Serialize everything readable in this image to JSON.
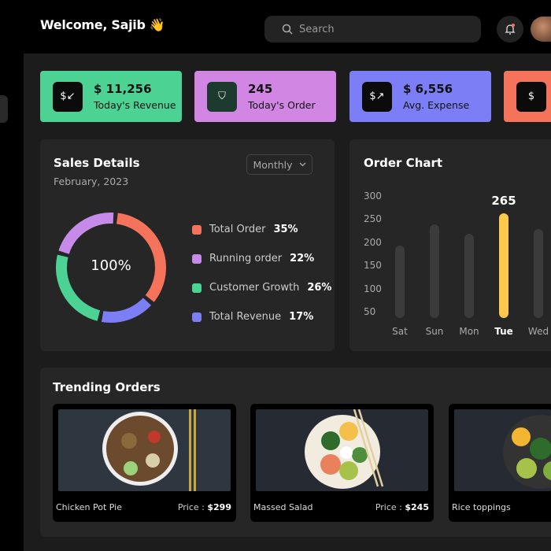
{
  "header": {
    "welcome": "Welcome, Sajib 👋",
    "search_placeholder": "Search"
  },
  "stats": [
    {
      "value": "$ 11,256",
      "label": "Today's Revenue",
      "color": "#4cd394",
      "icon": "dollar-in-icon"
    },
    {
      "value": "245",
      "label": "Today's Order",
      "color": "#d186e3",
      "icon": "user-shield-icon"
    },
    {
      "value": "$ 6,556",
      "label": "Avg. Expense",
      "color": "#7c7ef5",
      "icon": "dollar-out-icon"
    },
    {
      "value": "",
      "label": "",
      "color": "#f5735a",
      "icon": "dollar-icon"
    }
  ],
  "sales": {
    "title": "Sales Details",
    "subtitle": "February, 2023",
    "period": "Monthly",
    "center": "100%",
    "items": [
      {
        "label": "Total Order",
        "pct": "35%",
        "value": 35,
        "color": "#f5735a"
      },
      {
        "label": "Running order",
        "pct": "22%",
        "value": 22,
        "color": "#c68be8"
      },
      {
        "label": "Customer Growth",
        "pct": "26%",
        "value": 26,
        "color": "#4cd394"
      },
      {
        "label": "Total Revenue",
        "pct": "17%",
        "value": 17,
        "color": "#7c7ef5"
      }
    ]
  },
  "chart_data": {
    "type": "bar",
    "title": "Order Chart",
    "categories": [
      "Sat",
      "Sun",
      "Mon",
      "Tue",
      "Wed"
    ],
    "values": [
      195,
      240,
      220,
      265,
      230
    ],
    "yticks": [
      "300",
      "250",
      "200",
      "150",
      "100",
      "50"
    ],
    "ylim": [
      50,
      300
    ],
    "highlight": "Tue",
    "highlight_label": "265",
    "bar_color": "#3b3b3b",
    "highlight_color": "#fcc94a"
  },
  "trending": {
    "title": "Trending Orders",
    "items": [
      {
        "name": "Chicken Pot Pie",
        "price_label": "Price : ",
        "price": "$299"
      },
      {
        "name": "Massed Salad",
        "price_label": "Price : ",
        "price": "$245"
      },
      {
        "name": "Rice toppings",
        "price_label": "",
        "price": ""
      }
    ]
  }
}
